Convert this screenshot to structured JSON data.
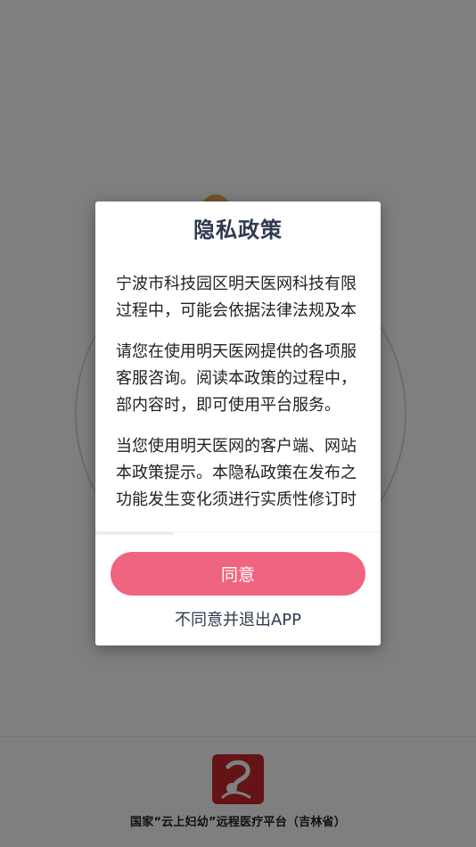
{
  "background": {
    "footer_text": "国家“云上妇幼”远程医疗平台（吉林省）",
    "logo_icon": "health-platform-logo-icon"
  },
  "dialog": {
    "title": "隐私政策",
    "paragraphs": [
      "宁波市科技园区明天医网科技有限\n过程中，可能会依据法律法规及本",
      "请您在使用明天医网提供的各项服\n客服咨询。阅读本政策的过程中，\n部内容时，即可使用平台服务。",
      "当您使用明天医网的客户端、网站\n本政策提示。本隐私政策在发布之\n功能发生变化须进行实质性修订时"
    ],
    "agree_label": "同意",
    "disagree_label": "不同意并退出APP"
  },
  "colors": {
    "accent": "#ef6580",
    "title": "#2f3a4f",
    "logo_red": "#c8262c"
  }
}
